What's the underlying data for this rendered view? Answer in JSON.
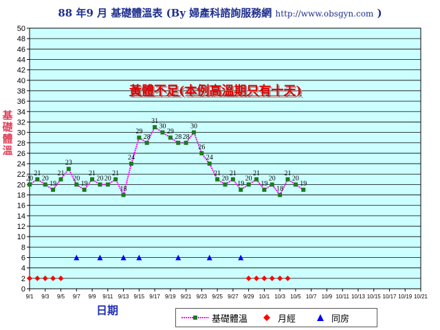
{
  "title": {
    "main": "88 年9 月 基礎體溫表 (By 婦產科諮詢服務網 ",
    "url": "http://www.obsgyn.com",
    "end": " )"
  },
  "annotation": "黃體不足(本例高溫期只有十天)",
  "colors": {
    "plot_bg": "#ccffff",
    "grid": "#000000",
    "line": "#ff00ff",
    "marker": "#1e7a1e",
    "period": "#ff0000",
    "intercourse": "#0000ff",
    "title": "#1f2f8f",
    "axis_text": "#1f2fb0"
  },
  "chart_data": {
    "type": "line",
    "title": "88 年9 月 基礎體溫表",
    "ylabel": "基礎體溫",
    "xlabel": "日期",
    "ylim": [
      0,
      50
    ],
    "yticks": [
      0,
      2,
      4,
      6,
      8,
      10,
      12,
      14,
      16,
      18,
      20,
      22,
      24,
      26,
      28,
      30,
      32,
      34,
      36,
      38,
      40,
      42,
      44,
      46,
      48,
      50
    ],
    "x_tick_labels": [
      "9/1",
      "9/3",
      "9/5",
      "9/7",
      "9/9",
      "9/11",
      "9/13",
      "9/15",
      "9/17",
      "9/19",
      "9/21",
      "9/23",
      "9/25",
      "9/27",
      "9/29",
      "10/1",
      "10/3",
      "10/5",
      "10/7",
      "10/9",
      "10/11",
      "10/13",
      "10/15",
      "10/17",
      "10/19",
      "10/21"
    ],
    "grid": true,
    "legend_position": "bottom",
    "legend": [
      "基礎體溫",
      "月經",
      "同房"
    ],
    "series": [
      {
        "name": "基礎體溫",
        "marker": "square",
        "values": [
          20,
          21,
          20,
          19,
          21,
          23,
          20,
          19,
          21,
          20,
          20,
          21,
          18,
          24,
          29,
          28,
          31,
          30,
          29,
          28,
          28,
          30,
          26,
          24,
          21,
          20,
          21,
          19,
          20,
          21,
          19,
          20,
          18,
          21,
          20,
          19
        ],
        "labels": [
          "20",
          "21",
          "20",
          "19",
          "21",
          "23",
          "20",
          "19",
          "21",
          "20",
          "20",
          "21",
          "18",
          "24",
          "29",
          "28",
          "31",
          "30",
          "29",
          "28",
          "28",
          "30",
          "26",
          "24",
          "21",
          "20",
          "21",
          "19",
          "20",
          "21",
          "19",
          "20",
          "18",
          "21",
          "20",
          "19"
        ]
      },
      {
        "name": "月經",
        "marker": "diamond",
        "days": [
          1,
          2,
          3,
          4,
          5,
          29,
          30,
          31,
          32,
          33,
          34
        ],
        "value": 2
      },
      {
        "name": "同房",
        "marker": "triangle",
        "days": [
          7,
          10,
          13,
          15,
          20,
          24,
          28
        ],
        "value": 6
      }
    ]
  }
}
